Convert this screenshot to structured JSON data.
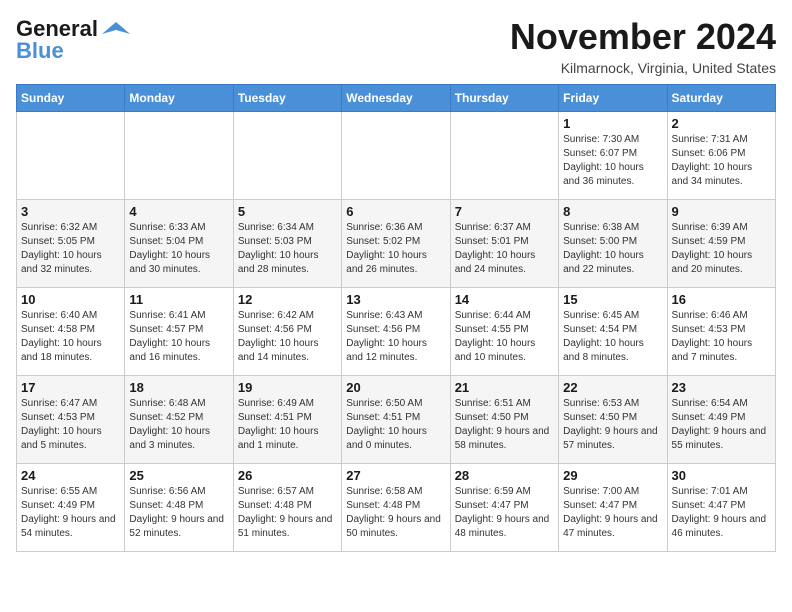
{
  "header": {
    "logo_general": "General",
    "logo_blue": "Blue",
    "month_title": "November 2024",
    "subtitle": "Kilmarnock, Virginia, United States"
  },
  "days_of_week": [
    "Sunday",
    "Monday",
    "Tuesday",
    "Wednesday",
    "Thursday",
    "Friday",
    "Saturday"
  ],
  "weeks": [
    [
      {
        "day": "",
        "content": ""
      },
      {
        "day": "",
        "content": ""
      },
      {
        "day": "",
        "content": ""
      },
      {
        "day": "",
        "content": ""
      },
      {
        "day": "",
        "content": ""
      },
      {
        "day": "1",
        "content": "Sunrise: 7:30 AM\nSunset: 6:07 PM\nDaylight: 10 hours and 36 minutes."
      },
      {
        "day": "2",
        "content": "Sunrise: 7:31 AM\nSunset: 6:06 PM\nDaylight: 10 hours and 34 minutes."
      }
    ],
    [
      {
        "day": "3",
        "content": "Sunrise: 6:32 AM\nSunset: 5:05 PM\nDaylight: 10 hours and 32 minutes."
      },
      {
        "day": "4",
        "content": "Sunrise: 6:33 AM\nSunset: 5:04 PM\nDaylight: 10 hours and 30 minutes."
      },
      {
        "day": "5",
        "content": "Sunrise: 6:34 AM\nSunset: 5:03 PM\nDaylight: 10 hours and 28 minutes."
      },
      {
        "day": "6",
        "content": "Sunrise: 6:36 AM\nSunset: 5:02 PM\nDaylight: 10 hours and 26 minutes."
      },
      {
        "day": "7",
        "content": "Sunrise: 6:37 AM\nSunset: 5:01 PM\nDaylight: 10 hours and 24 minutes."
      },
      {
        "day": "8",
        "content": "Sunrise: 6:38 AM\nSunset: 5:00 PM\nDaylight: 10 hours and 22 minutes."
      },
      {
        "day": "9",
        "content": "Sunrise: 6:39 AM\nSunset: 4:59 PM\nDaylight: 10 hours and 20 minutes."
      }
    ],
    [
      {
        "day": "10",
        "content": "Sunrise: 6:40 AM\nSunset: 4:58 PM\nDaylight: 10 hours and 18 minutes."
      },
      {
        "day": "11",
        "content": "Sunrise: 6:41 AM\nSunset: 4:57 PM\nDaylight: 10 hours and 16 minutes."
      },
      {
        "day": "12",
        "content": "Sunrise: 6:42 AM\nSunset: 4:56 PM\nDaylight: 10 hours and 14 minutes."
      },
      {
        "day": "13",
        "content": "Sunrise: 6:43 AM\nSunset: 4:56 PM\nDaylight: 10 hours and 12 minutes."
      },
      {
        "day": "14",
        "content": "Sunrise: 6:44 AM\nSunset: 4:55 PM\nDaylight: 10 hours and 10 minutes."
      },
      {
        "day": "15",
        "content": "Sunrise: 6:45 AM\nSunset: 4:54 PM\nDaylight: 10 hours and 8 minutes."
      },
      {
        "day": "16",
        "content": "Sunrise: 6:46 AM\nSunset: 4:53 PM\nDaylight: 10 hours and 7 minutes."
      }
    ],
    [
      {
        "day": "17",
        "content": "Sunrise: 6:47 AM\nSunset: 4:53 PM\nDaylight: 10 hours and 5 minutes."
      },
      {
        "day": "18",
        "content": "Sunrise: 6:48 AM\nSunset: 4:52 PM\nDaylight: 10 hours and 3 minutes."
      },
      {
        "day": "19",
        "content": "Sunrise: 6:49 AM\nSunset: 4:51 PM\nDaylight: 10 hours and 1 minute."
      },
      {
        "day": "20",
        "content": "Sunrise: 6:50 AM\nSunset: 4:51 PM\nDaylight: 10 hours and 0 minutes."
      },
      {
        "day": "21",
        "content": "Sunrise: 6:51 AM\nSunset: 4:50 PM\nDaylight: 9 hours and 58 minutes."
      },
      {
        "day": "22",
        "content": "Sunrise: 6:53 AM\nSunset: 4:50 PM\nDaylight: 9 hours and 57 minutes."
      },
      {
        "day": "23",
        "content": "Sunrise: 6:54 AM\nSunset: 4:49 PM\nDaylight: 9 hours and 55 minutes."
      }
    ],
    [
      {
        "day": "24",
        "content": "Sunrise: 6:55 AM\nSunset: 4:49 PM\nDaylight: 9 hours and 54 minutes."
      },
      {
        "day": "25",
        "content": "Sunrise: 6:56 AM\nSunset: 4:48 PM\nDaylight: 9 hours and 52 minutes."
      },
      {
        "day": "26",
        "content": "Sunrise: 6:57 AM\nSunset: 4:48 PM\nDaylight: 9 hours and 51 minutes."
      },
      {
        "day": "27",
        "content": "Sunrise: 6:58 AM\nSunset: 4:48 PM\nDaylight: 9 hours and 50 minutes."
      },
      {
        "day": "28",
        "content": "Sunrise: 6:59 AM\nSunset: 4:47 PM\nDaylight: 9 hours and 48 minutes."
      },
      {
        "day": "29",
        "content": "Sunrise: 7:00 AM\nSunset: 4:47 PM\nDaylight: 9 hours and 47 minutes."
      },
      {
        "day": "30",
        "content": "Sunrise: 7:01 AM\nSunset: 4:47 PM\nDaylight: 9 hours and 46 minutes."
      }
    ]
  ]
}
